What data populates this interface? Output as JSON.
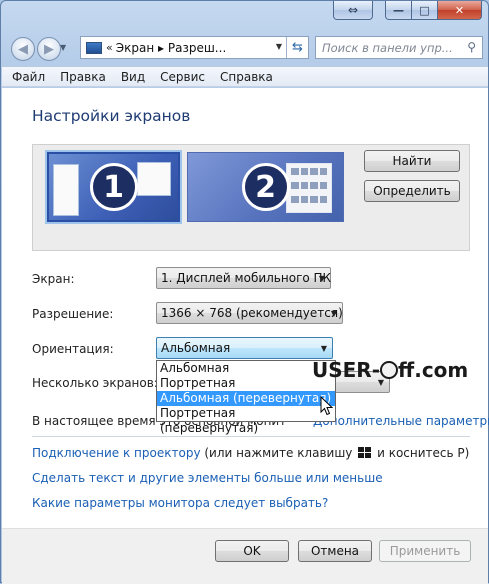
{
  "window": {
    "titlebar_extra_icon": "restore-down-icon",
    "minimize": "—",
    "maximize": "□",
    "close": "✕"
  },
  "nav": {
    "breadcrumb_chevron": "«",
    "path": "Экран ▸ Разреш...",
    "path_parts": [
      "Экран",
      "Разреш..."
    ],
    "search_placeholder": "Поиск в панели упр..."
  },
  "menu": [
    "Файл",
    "Правка",
    "Вид",
    "Сервис",
    "Справка"
  ],
  "page": {
    "title": "Настройки экранов",
    "detect_button": "Найти",
    "identify_button": "Определить",
    "monitor1_number": "1",
    "monitor2_number": "2"
  },
  "fields": {
    "screen_label": "Экран:",
    "screen_value": "1. Дисплей мобильного ПК",
    "resolution_label": "Разрешение:",
    "resolution_value": "1366 × 768 (рекомендуется)",
    "orientation_label": "Ориентация:",
    "orientation_value": "Альбомная",
    "multiple_label": "Несколько экранов:"
  },
  "orientation_options": [
    "Альбомная",
    "Портретная",
    "Альбомная (перевернутая)",
    "Портретная (перевернутая)"
  ],
  "orientation_highlighted_index": 2,
  "info": {
    "main_monitor_text": "В настоящее время это основной монитор.",
    "advanced_link": "Дополнительные параметры"
  },
  "links": {
    "projector": "Подключение к проектору",
    "projector_suffix_1": "(или нажмите клавишу",
    "projector_suffix_2": "и коснитесь P)",
    "text_size": "Сделать текст и другие элементы больше или меньше",
    "which_params": "Какие параметры монитора следует выбрать?"
  },
  "buttons": {
    "ok": "OK",
    "cancel": "Отмена",
    "apply": "Применить"
  },
  "watermark": {
    "part1": "USER-",
    "part2": "ff.com"
  },
  "colors": {
    "link": "#1a5fb4",
    "title": "#1e3b74",
    "highlight": "#3399ff"
  }
}
